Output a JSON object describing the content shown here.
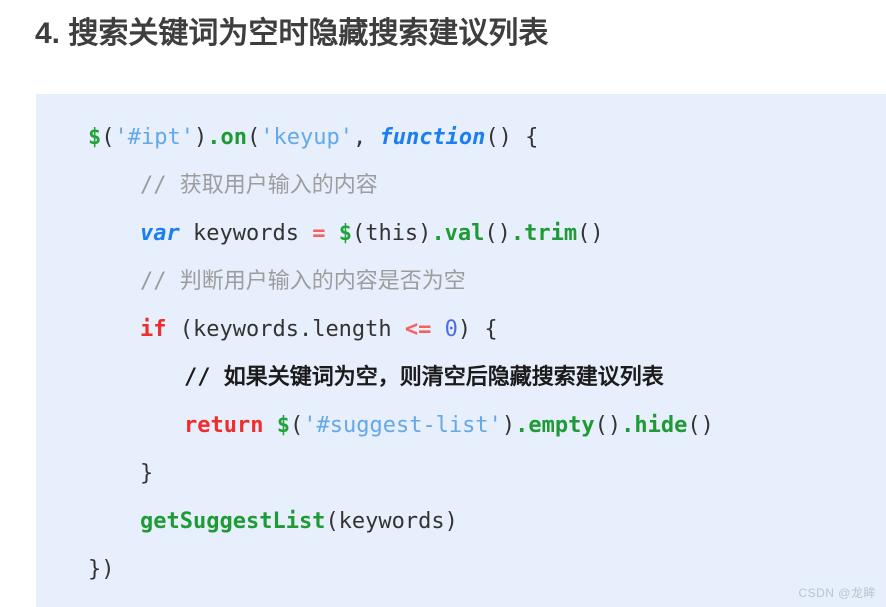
{
  "page": {
    "title": "4. 搜索关键词为空时隐藏搜索建议列表",
    "background_color": "#ffffff",
    "title_color": "#3e3e3e"
  },
  "code_block": {
    "background_color": "#e7eefc",
    "language": "javascript",
    "lines": [
      {
        "indent": 0,
        "tokens": [
          {
            "type": "dollar",
            "text": "$"
          },
          {
            "type": "punct",
            "text": "("
          },
          {
            "type": "string",
            "text": "'#ipt'"
          },
          {
            "type": "punct",
            "text": ")"
          },
          {
            "type": "method",
            "text": ".on"
          },
          {
            "type": "punct",
            "text": "("
          },
          {
            "type": "string",
            "text": "'keyup'"
          },
          {
            "type": "punct",
            "text": ", "
          },
          {
            "type": "kw-blue",
            "text": "function"
          },
          {
            "type": "punct",
            "text": "() {"
          }
        ]
      },
      {
        "indent": 1,
        "tokens": [
          {
            "type": "comment",
            "text": "// 获取用户输入的内容"
          }
        ]
      },
      {
        "indent": 1,
        "tokens": [
          {
            "type": "kw-blue",
            "text": "var"
          },
          {
            "type": "plain",
            "text": " keywords "
          },
          {
            "type": "op-red",
            "text": "="
          },
          {
            "type": "plain",
            "text": " "
          },
          {
            "type": "dollar",
            "text": "$"
          },
          {
            "type": "punct",
            "text": "(this)"
          },
          {
            "type": "method",
            "text": ".val"
          },
          {
            "type": "punct",
            "text": "()"
          },
          {
            "type": "method",
            "text": ".trim"
          },
          {
            "type": "punct",
            "text": "()"
          }
        ]
      },
      {
        "indent": 1,
        "tokens": [
          {
            "type": "comment",
            "text": "// 判断用户输入的内容是否为空"
          }
        ]
      },
      {
        "indent": 1,
        "tokens": [
          {
            "type": "kw-red",
            "text": "if"
          },
          {
            "type": "plain",
            "text": " (keywords.length "
          },
          {
            "type": "op-red",
            "text": "<="
          },
          {
            "type": "plain",
            "text": " "
          },
          {
            "type": "num",
            "text": "0"
          },
          {
            "type": "punct",
            "text": ") {"
          }
        ]
      },
      {
        "indent": 2,
        "tokens": [
          {
            "type": "comment-strong",
            "text": "// 如果关键词为空，则清空后隐藏搜索建议列表"
          }
        ]
      },
      {
        "indent": 2,
        "tokens": [
          {
            "type": "kw-red",
            "text": "return"
          },
          {
            "type": "plain",
            "text": " "
          },
          {
            "type": "dollar",
            "text": "$"
          },
          {
            "type": "punct",
            "text": "("
          },
          {
            "type": "string",
            "text": "'#suggest-list'"
          },
          {
            "type": "punct",
            "text": ")"
          },
          {
            "type": "method",
            "text": ".empty"
          },
          {
            "type": "punct",
            "text": "()"
          },
          {
            "type": "method",
            "text": ".hide"
          },
          {
            "type": "punct",
            "text": "()"
          }
        ]
      },
      {
        "indent": 1,
        "tokens": [
          {
            "type": "punct",
            "text": "}"
          }
        ]
      },
      {
        "indent": 1,
        "tokens": [
          {
            "type": "func",
            "text": "getSuggestList"
          },
          {
            "type": "punct",
            "text": "(keywords)"
          }
        ]
      },
      {
        "indent": 0,
        "tokens": [
          {
            "type": "punct",
            "text": "})"
          }
        ]
      }
    ]
  },
  "watermark": {
    "text": "CSDN @龙眸",
    "color": "#b9c3d6"
  }
}
